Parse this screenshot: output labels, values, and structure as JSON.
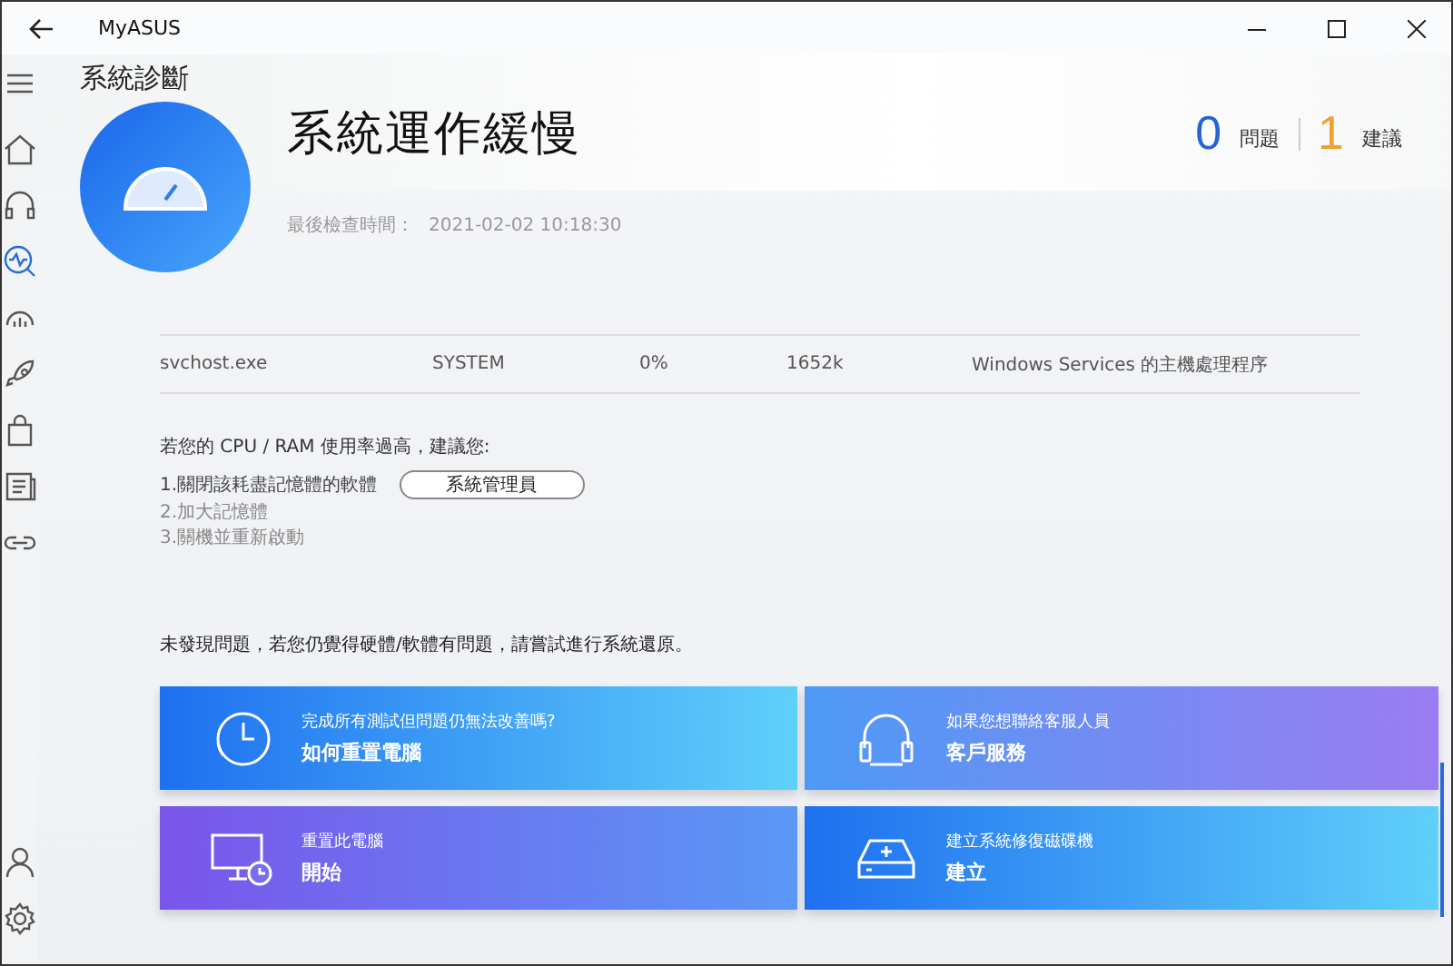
{
  "window": {
    "title": "MyASUS"
  },
  "sidebar": {
    "items": [
      {
        "kind": "home",
        "selected": false
      },
      {
        "kind": "headset",
        "selected": false
      },
      {
        "kind": "diagnosis",
        "selected": true
      },
      {
        "kind": "meter",
        "selected": false
      },
      {
        "kind": "rocket",
        "selected": false
      },
      {
        "kind": "bag",
        "selected": false
      },
      {
        "kind": "news",
        "selected": false
      },
      {
        "kind": "link",
        "selected": false
      }
    ],
    "bottom": [
      {
        "kind": "user",
        "selected": false
      },
      {
        "kind": "settings",
        "selected": false
      }
    ]
  },
  "page_title": "系統診斷",
  "result": {
    "title": "系統運作緩慢",
    "last_check_label": "最後檢查時間：",
    "last_check_time": "2021-02-02 10:18:30",
    "issues_count": "0",
    "issues_label": "問題",
    "suggestions_count": "1",
    "suggestions_label": "建議"
  },
  "table": {
    "rows": [
      [
        "svchost.exe",
        "SYSTEM",
        "0%",
        "1652k",
        "Windows Services 的主機處理程序"
      ]
    ]
  },
  "advice": {
    "intro": "若您的 CPU / RAM 使用率過高，建議您:",
    "steps": [
      "1.關閉該耗盡記憶體的軟體",
      "2.加大記憶體",
      "3.關機並重新啟動"
    ],
    "button": "系統管理員"
  },
  "note": "未發現問題，若您仍覺得硬體/軟體有問題，請嘗試進行系統還原。",
  "cards": [
    {
      "kind": "clock",
      "subtitle": "完成所有測試但問題仍無法改善嗎?",
      "title": "如何重置電腦"
    },
    {
      "kind": "headset",
      "subtitle": "如果您想聯絡客服人員",
      "title": "客戶服務"
    },
    {
      "kind": "monitor",
      "subtitle": "重置此電腦",
      "title": "開始"
    },
    {
      "kind": "drive",
      "subtitle": "建立系統修復磁碟機",
      "title": "建立"
    }
  ]
}
